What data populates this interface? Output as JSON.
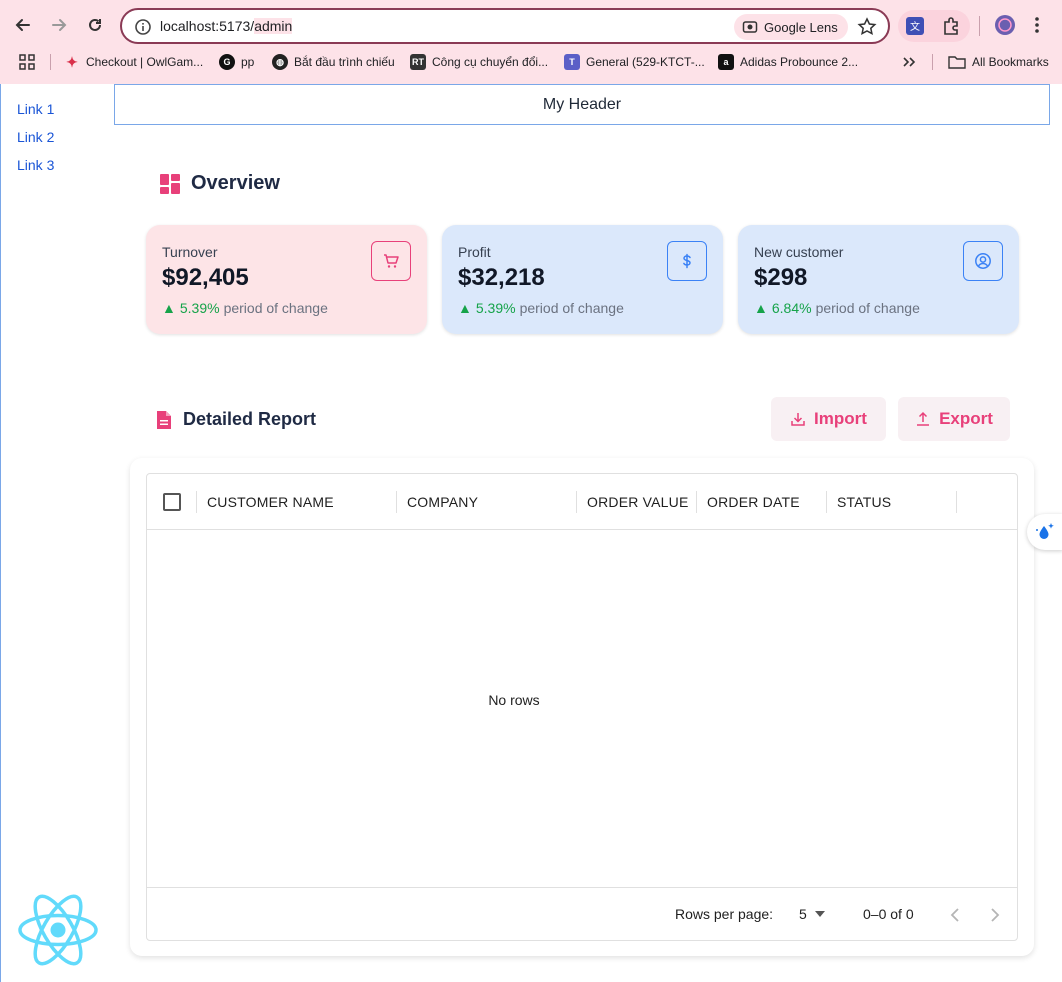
{
  "browser": {
    "url_host": "localhost:5173/",
    "url_path": "admin",
    "lens_label": "Google Lens",
    "bookmarks": [
      {
        "label": "Checkout | OwlGam...",
        "icon": "owl-icon"
      },
      {
        "label": "pp",
        "icon": "g-logo-icon"
      },
      {
        "label": "Bắt đầu trình chiếu",
        "icon": "globe-icon"
      },
      {
        "label": "Công cụ chuyển đổi...",
        "icon": "rt-icon"
      },
      {
        "label": "General (529-KTCT-...",
        "icon": "teams-icon"
      },
      {
        "label": "Adidas Probounce 2...",
        "icon": "adidas-icon"
      }
    ],
    "all_bookmarks": "All Bookmarks"
  },
  "sidebar": {
    "links": [
      "Link 1",
      "Link 2",
      "Link 3"
    ]
  },
  "header": {
    "title": "My Header"
  },
  "overview": {
    "title": "Overview",
    "cards": [
      {
        "label": "Turnover",
        "value": "$92,405",
        "pct": "5.39%",
        "suffix": "period of change",
        "icon": "cart-icon",
        "bg": "#fde4e7",
        "accent": "#e8407a"
      },
      {
        "label": "Profit",
        "value": "$32,218",
        "pct": "5.39%",
        "suffix": "period of change",
        "icon": "dollar-icon",
        "bg": "#dbe8fb",
        "accent": "#3b82f6"
      },
      {
        "label": "New customer",
        "value": "$298",
        "pct": "6.84%",
        "suffix": "period of change",
        "icon": "user-circle-icon",
        "bg": "#dbe8fb",
        "accent": "#3b82f6"
      }
    ]
  },
  "report": {
    "title": "Detailed Report",
    "import_label": "Import",
    "export_label": "Export",
    "columns": [
      "CUSTOMER NAME",
      "COMPANY",
      "ORDER VALUE",
      "ORDER DATE",
      "STATUS"
    ],
    "empty_text": "No rows",
    "rows_per_page_label": "Rows per page:",
    "rows_per_page_value": "5",
    "range_text": "0–0 of 0"
  },
  "colors": {
    "brand_pink": "#e8407a",
    "link_blue": "#1a55d6",
    "positive": "#16a34a"
  }
}
